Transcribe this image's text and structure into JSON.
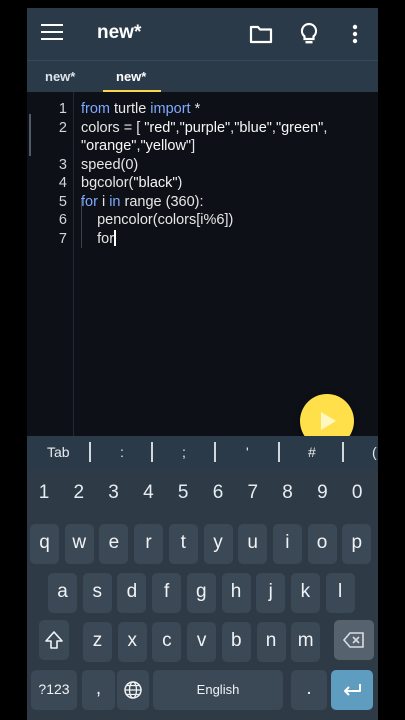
{
  "appbar": {
    "title": "new*"
  },
  "tabs": [
    {
      "label": "new*"
    },
    {
      "label": "new*"
    }
  ],
  "editor": {
    "lines": [
      {
        "n": "1",
        "parts": [
          [
            "kw",
            "from"
          ],
          [
            "t",
            " turtle "
          ],
          [
            "kw",
            "import"
          ],
          [
            "t",
            " *"
          ]
        ]
      },
      {
        "n": "2",
        "parts": [
          [
            "t",
            "colors = [ "
          ],
          [
            "s",
            "\"red\""
          ],
          [
            "t",
            ","
          ],
          [
            "s",
            "\"purple\""
          ],
          [
            "t",
            ","
          ],
          [
            "s",
            "\"blue\""
          ],
          [
            "t",
            ","
          ],
          [
            "s",
            "\"green\""
          ],
          [
            "t",
            ","
          ]
        ]
      },
      {
        "n": "",
        "parts": [
          [
            "s",
            "\"orange\""
          ],
          [
            "t",
            ","
          ],
          [
            "s",
            "\"yellow\""
          ],
          [
            "t",
            "]"
          ]
        ]
      },
      {
        "n": "3",
        "parts": [
          [
            "t",
            "speed(0)"
          ]
        ]
      },
      {
        "n": "4",
        "parts": [
          [
            "t",
            "bgcolor("
          ],
          [
            "s",
            "\"black\""
          ],
          [
            "t",
            ")"
          ]
        ]
      },
      {
        "n": "5",
        "parts": [
          [
            "kw",
            "for"
          ],
          [
            "t",
            " i "
          ],
          [
            "kw",
            "in"
          ],
          [
            "t",
            " range (360):"
          ]
        ]
      },
      {
        "n": "6",
        "parts": [
          [
            "t",
            "    pencolor(colors[i%6])"
          ]
        ]
      },
      {
        "n": "7",
        "parts": [
          [
            "t",
            "    for"
          ]
        ]
      }
    ]
  },
  "symbols": [
    "Tab",
    ":",
    ";",
    "'",
    "#",
    "("
  ],
  "keyboard": {
    "numbers": [
      "1",
      "2",
      "3",
      "4",
      "5",
      "6",
      "7",
      "8",
      "9",
      "0"
    ],
    "row1": [
      "q",
      "w",
      "e",
      "r",
      "t",
      "y",
      "u",
      "i",
      "o",
      "p"
    ],
    "row2": [
      "a",
      "s",
      "d",
      "f",
      "g",
      "h",
      "j",
      "k",
      "l"
    ],
    "row3": [
      "z",
      "x",
      "c",
      "v",
      "b",
      "n",
      "m"
    ],
    "mode_label": "?123",
    "comma": ",",
    "space_label": "English",
    "period": "."
  },
  "colors": {
    "appbar": "#2b3a49",
    "accent": "#ffd54a",
    "keyword": "#7fa9ff",
    "enter": "#5e9cc0"
  }
}
